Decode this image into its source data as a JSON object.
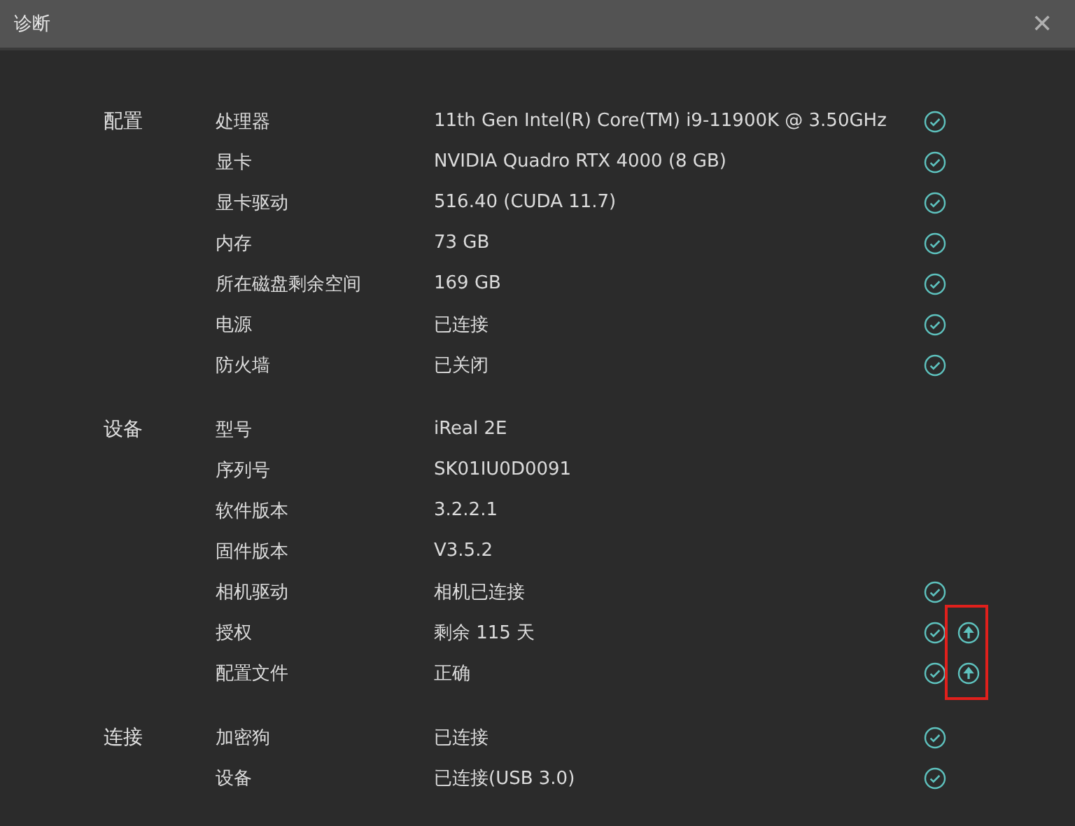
{
  "window": {
    "title": "诊断",
    "close": "✕"
  },
  "sections": [
    {
      "label": "配置",
      "rows": [
        {
          "key": "处理器",
          "value": "11th Gen Intel(R) Core(TM) i9-11900K @ 3.50GHz",
          "checked": true,
          "upload": false,
          "marked": false
        },
        {
          "key": "显卡",
          "value": "NVIDIA Quadro RTX 4000 (8 GB)",
          "checked": true,
          "upload": false,
          "marked": false
        },
        {
          "key": "显卡驱动",
          "value": "516.40 (CUDA 11.7)",
          "checked": true,
          "upload": false,
          "marked": false
        },
        {
          "key": "内存",
          "value": "73 GB",
          "checked": true,
          "upload": false,
          "marked": false
        },
        {
          "key": "所在磁盘剩余空间",
          "value": "169 GB",
          "checked": true,
          "upload": false,
          "marked": false
        },
        {
          "key": "电源",
          "value": "已连接",
          "checked": true,
          "upload": false,
          "marked": false
        },
        {
          "key": "防火墙",
          "value": "已关闭",
          "checked": true,
          "upload": false,
          "marked": false
        }
      ]
    },
    {
      "label": "设备",
      "rows": [
        {
          "key": "型号",
          "value": "iReal 2E",
          "checked": false,
          "upload": false,
          "marked": false
        },
        {
          "key": "序列号",
          "value": "SK01IU0D0091",
          "checked": false,
          "upload": false,
          "marked": false
        },
        {
          "key": "软件版本",
          "value": "3.2.2.1",
          "checked": false,
          "upload": false,
          "marked": false
        },
        {
          "key": "固件版本",
          "value": "V3.5.2",
          "checked": false,
          "upload": false,
          "marked": false
        },
        {
          "key": "相机驱动",
          "value": "相机已连接",
          "checked": true,
          "upload": false,
          "marked": false
        },
        {
          "key": "授权",
          "value": "剩余 115 天",
          "checked": true,
          "upload": true,
          "marked": true
        },
        {
          "key": "配置文件",
          "value": "正确",
          "checked": true,
          "upload": true,
          "marked": true
        }
      ]
    },
    {
      "label": "连接",
      "rows": [
        {
          "key": "加密狗",
          "value": "已连接",
          "checked": true,
          "upload": false,
          "marked": false
        },
        {
          "key": "设备",
          "value": "已连接(USB 3.0)",
          "checked": true,
          "upload": false,
          "marked": false
        }
      ]
    }
  ]
}
